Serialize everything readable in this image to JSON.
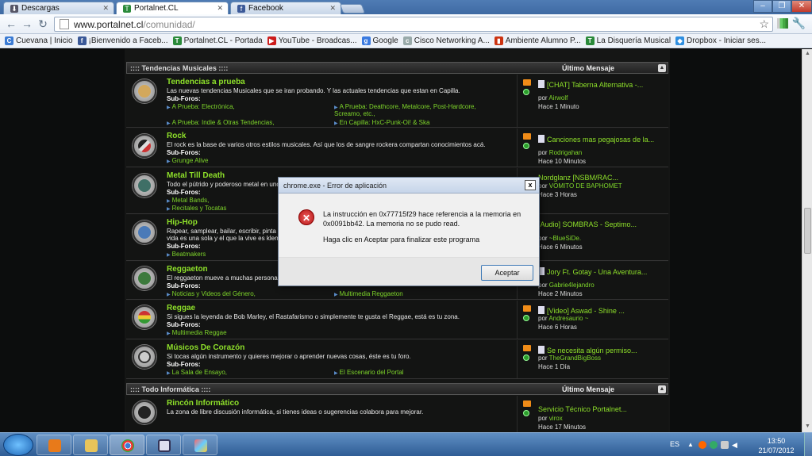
{
  "browser": {
    "tabs": [
      {
        "label": "Descargas",
        "icon": "download-icon",
        "active": false
      },
      {
        "label": "Portalnet.CL",
        "icon": "portalnet-icon",
        "active": true
      },
      {
        "label": "Facebook",
        "icon": "facebook-icon",
        "active": false
      }
    ],
    "url_host": "www.portalnet.cl",
    "url_path": "/comunidad/",
    "bookmarks": [
      {
        "label": "Cuevana | Inicio",
        "icon": "cuevana-icon",
        "color": "#3b7bd4"
      },
      {
        "label": "¡Bienvenido a Faceb...",
        "icon": "facebook-icon",
        "color": "#3b5998"
      },
      {
        "label": "Portalnet.CL - Portada",
        "icon": "portalnet-icon",
        "color": "#2a8a3a"
      },
      {
        "label": "YouTube - Broadcas...",
        "icon": "youtube-icon",
        "color": "#cc1b1b"
      },
      {
        "label": "Google",
        "icon": "google-icon",
        "color": "#3a7ae0"
      },
      {
        "label": "Cisco Networking A...",
        "icon": "cisco-icon",
        "color": "#9aa"
      },
      {
        "label": "Ambiente Alumno P...",
        "icon": "bookmark-icon",
        "color": "#c31"
      },
      {
        "label": "La Disquería Musical",
        "icon": "portalnet-icon",
        "color": "#2a8a3a"
      },
      {
        "label": "Dropbox - Iniciar ses...",
        "icon": "dropbox-icon",
        "color": "#2f8fe0"
      }
    ]
  },
  "forum": {
    "sections": [
      {
        "title": ":::: Tendencias Musicales ::::",
        "last_label": "Último Mensaje",
        "rows": [
          {
            "title": "Tendencias a prueba",
            "desc": "Las nuevas tendencias Musicales que se iran probando. Y las actuales tendencias que estan en Capilla.",
            "sublabel": "Sub-Foros:",
            "subs": [
              "A Prueba: Electrónica,",
              "A Prueba: Deathcore, Metalcore, Post-Hardcore, Screamo, etc.,",
              "A Prueba: Indie & Otras Tendencias,",
              "En Capilla: HxC-Punk-Oi! & Ska"
            ],
            "last_title": "[CHAT] Taberna Alternativa -...",
            "last_by": "Airwolf",
            "last_time": "Hace 1 Minuto"
          },
          {
            "title": "Rock",
            "desc": "El rock es la base de varios otros estilos musicales. Así que los de sangre rockera compartan conocimientos acá.",
            "sublabel": "Sub-Foros:",
            "subs": [
              "Grunge Alive"
            ],
            "last_title": "Canciones mas pegajosas de la...",
            "last_by": "Rodrigahan",
            "last_time": "Hace 10 Minutos"
          },
          {
            "title": "Metal Till Death",
            "desc": "Todo el pútrido y poderoso metal en uno",
            "sublabel": "Sub-Foros:",
            "subs": [
              "Metal Bands,",
              "Recitales y Tocatas"
            ],
            "last_title": "Nordglanz [NSBM/RAC...",
            "last_by": "VOMITO DE BAPHOMET",
            "last_time": "Hace 3 Horas"
          },
          {
            "title": "Hip-Hop",
            "desc": "Rapear, samplear, bailar, escribir, pinta",
            "desc2": "vida es una sola y el que la vive es klen",
            "sublabel": "Sub-Foros:",
            "subs": [
              "Beatmakers"
            ],
            "last_title": "[Audio] SOMBRAS - Septimo...",
            "last_by": "~BlueSiDe.",
            "last_time": "Hace 6 Minutos"
          },
          {
            "title": "Reggaeton",
            "desc": "El reggaeton mueve a muchas personas",
            "sublabel": "Sub-Foros:",
            "subs": [
              "Noticias y Videos del Género,",
              "Multimedia Reggaeton"
            ],
            "last_title": "Jory Ft. Gotay - Una Aventura...",
            "last_by": "Gabrie4lejandro",
            "last_time": "Hace 2 Minutos"
          },
          {
            "title": "Reggae",
            "desc": "Si sigues la leyenda de Bob Marley, el Rastafarismo o simplemente te gusta el Reggae, está es tu zona.",
            "sublabel": "Sub-Foros:",
            "subs": [
              "Multimedia Reggae"
            ],
            "last_title": "[Video] Aswad - Shine ...",
            "last_by": "Andresaurio ~",
            "last_time": "Hace 6 Horas"
          },
          {
            "title": "Músicos De Corazón",
            "desc": "Si tocas algún instrumento y quieres mejorar o aprender nuevas cosas, éste es tu foro.",
            "sublabel": "Sub-Foros:",
            "subs": [
              "La Sala de Ensayo,",
              "El Escenario del Portal"
            ],
            "last_title": "Se necesita algún permiso...",
            "last_by": "TheGrandBigBoss",
            "last_time": "Hace 1 Día"
          }
        ]
      },
      {
        "title": ":::: Todo Informática ::::",
        "last_label": "Último Mensaje",
        "rows": [
          {
            "title": "Rincón Informático",
            "desc": "La zona de libre discusión informática, si tienes ideas o sugerencias colabora para mejorar.",
            "last_title": "Servicio Técnico Portalnet...",
            "last_by": "virox",
            "last_time": "Hace 17 Minutos"
          }
        ]
      }
    ],
    "by_prefix": "por"
  },
  "dialog": {
    "title": "chrome.exe - Error de aplicación",
    "message": "La instrucción en 0x77715f29 hace referencia a la memoria en 0x0091bb42. La memoria no se pudo read.",
    "message2": "Haga clic en Aceptar para finalizar este programa",
    "ok_label": "Aceptar",
    "close_label": "x"
  },
  "taskbar": {
    "lang": "ES",
    "time": "13:50",
    "date": "21/07/2012"
  }
}
